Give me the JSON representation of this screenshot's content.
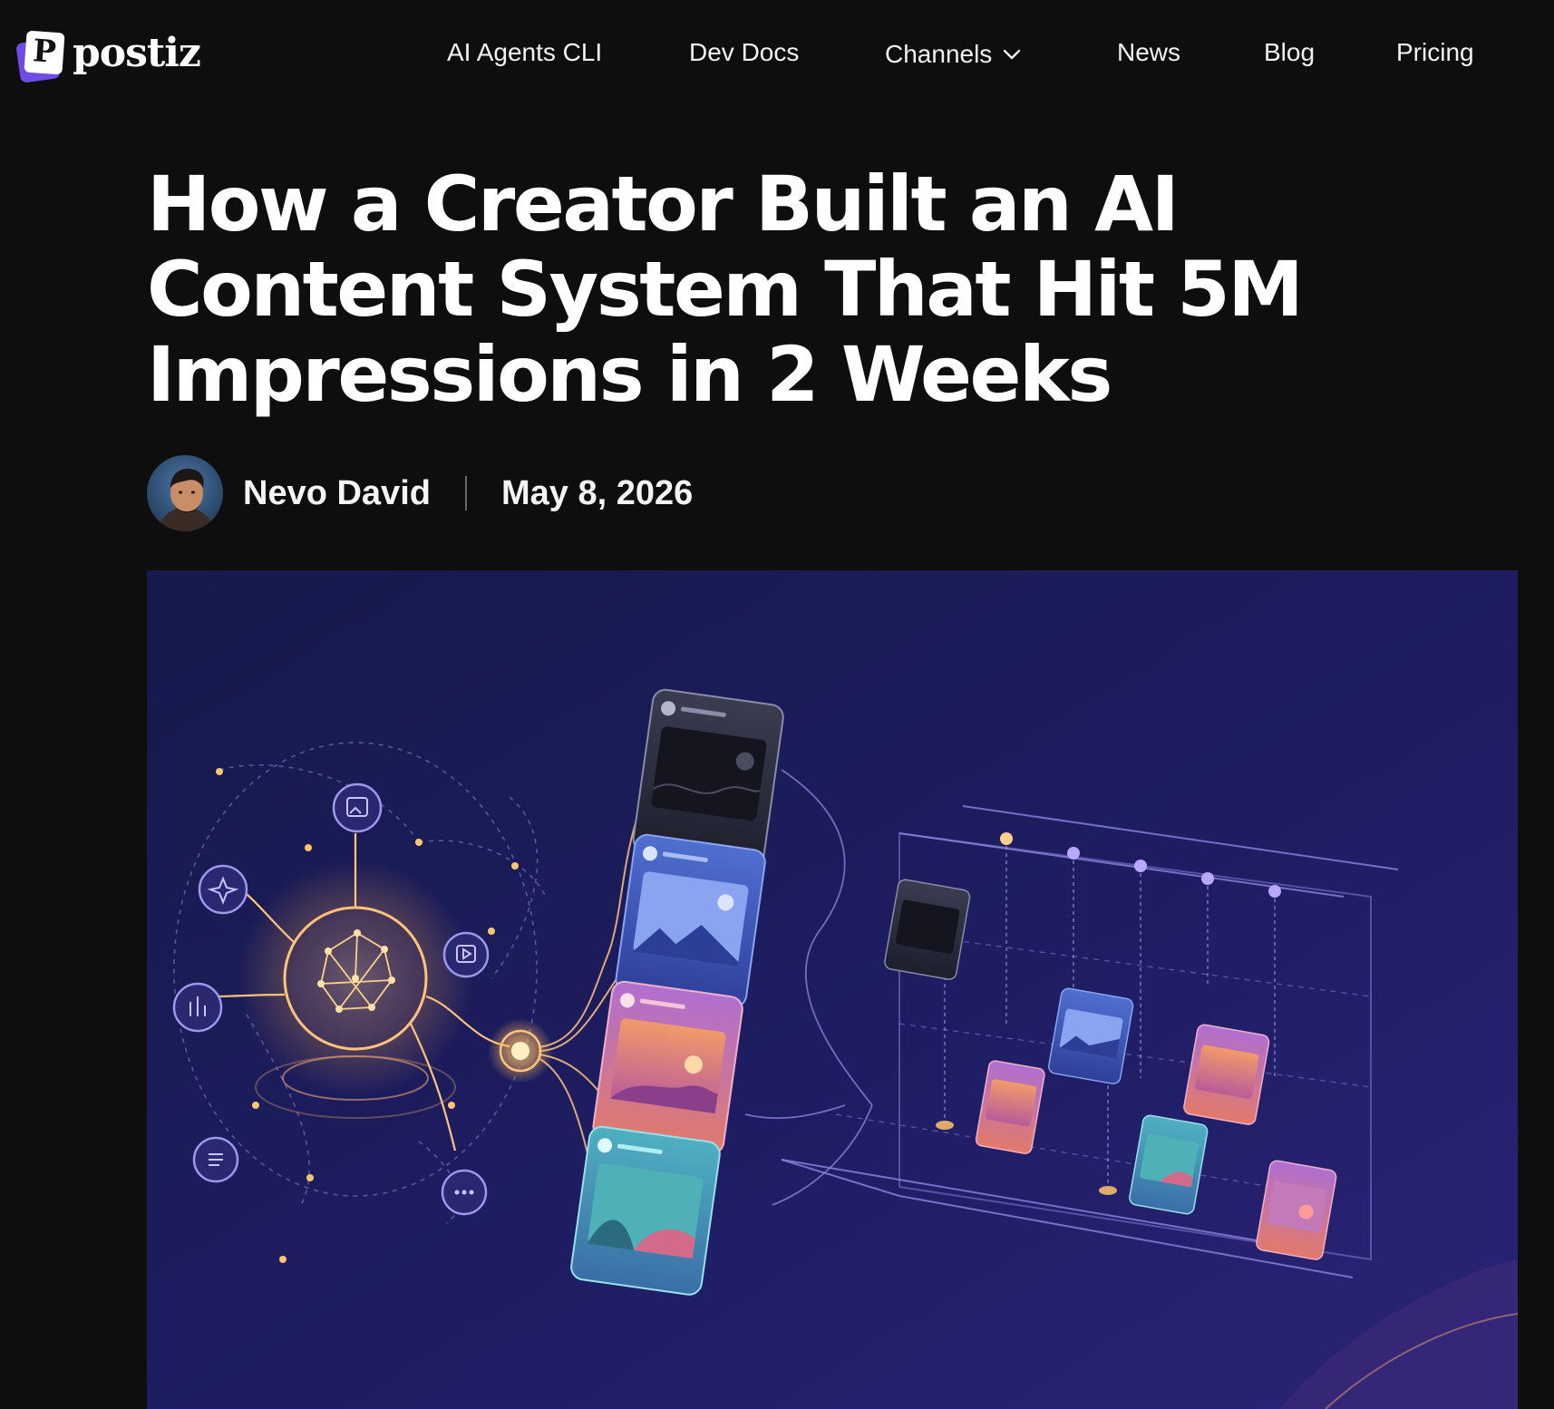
{
  "nav": {
    "logo_text": "postiz",
    "logo_letter": "P",
    "items": [
      {
        "label": "AI Agents CLI"
      },
      {
        "label": "Dev Docs"
      },
      {
        "label": "Channels"
      },
      {
        "label": "News"
      },
      {
        "label": "Blog"
      },
      {
        "label": "Pricing"
      }
    ],
    "channels_icon": "chevron-down-icon"
  },
  "article": {
    "title": "How a Creator Built an AI Content System That Hit 5M Impressions in 2 Weeks",
    "author": "Nevo David",
    "date": "May 8, 2026"
  },
  "colors": {
    "background": "#0e0e0e",
    "text": "#ffffff",
    "brand": "#6e4ce5",
    "hero_bg": "#1d1b5e",
    "glow": "#ffc56b"
  }
}
